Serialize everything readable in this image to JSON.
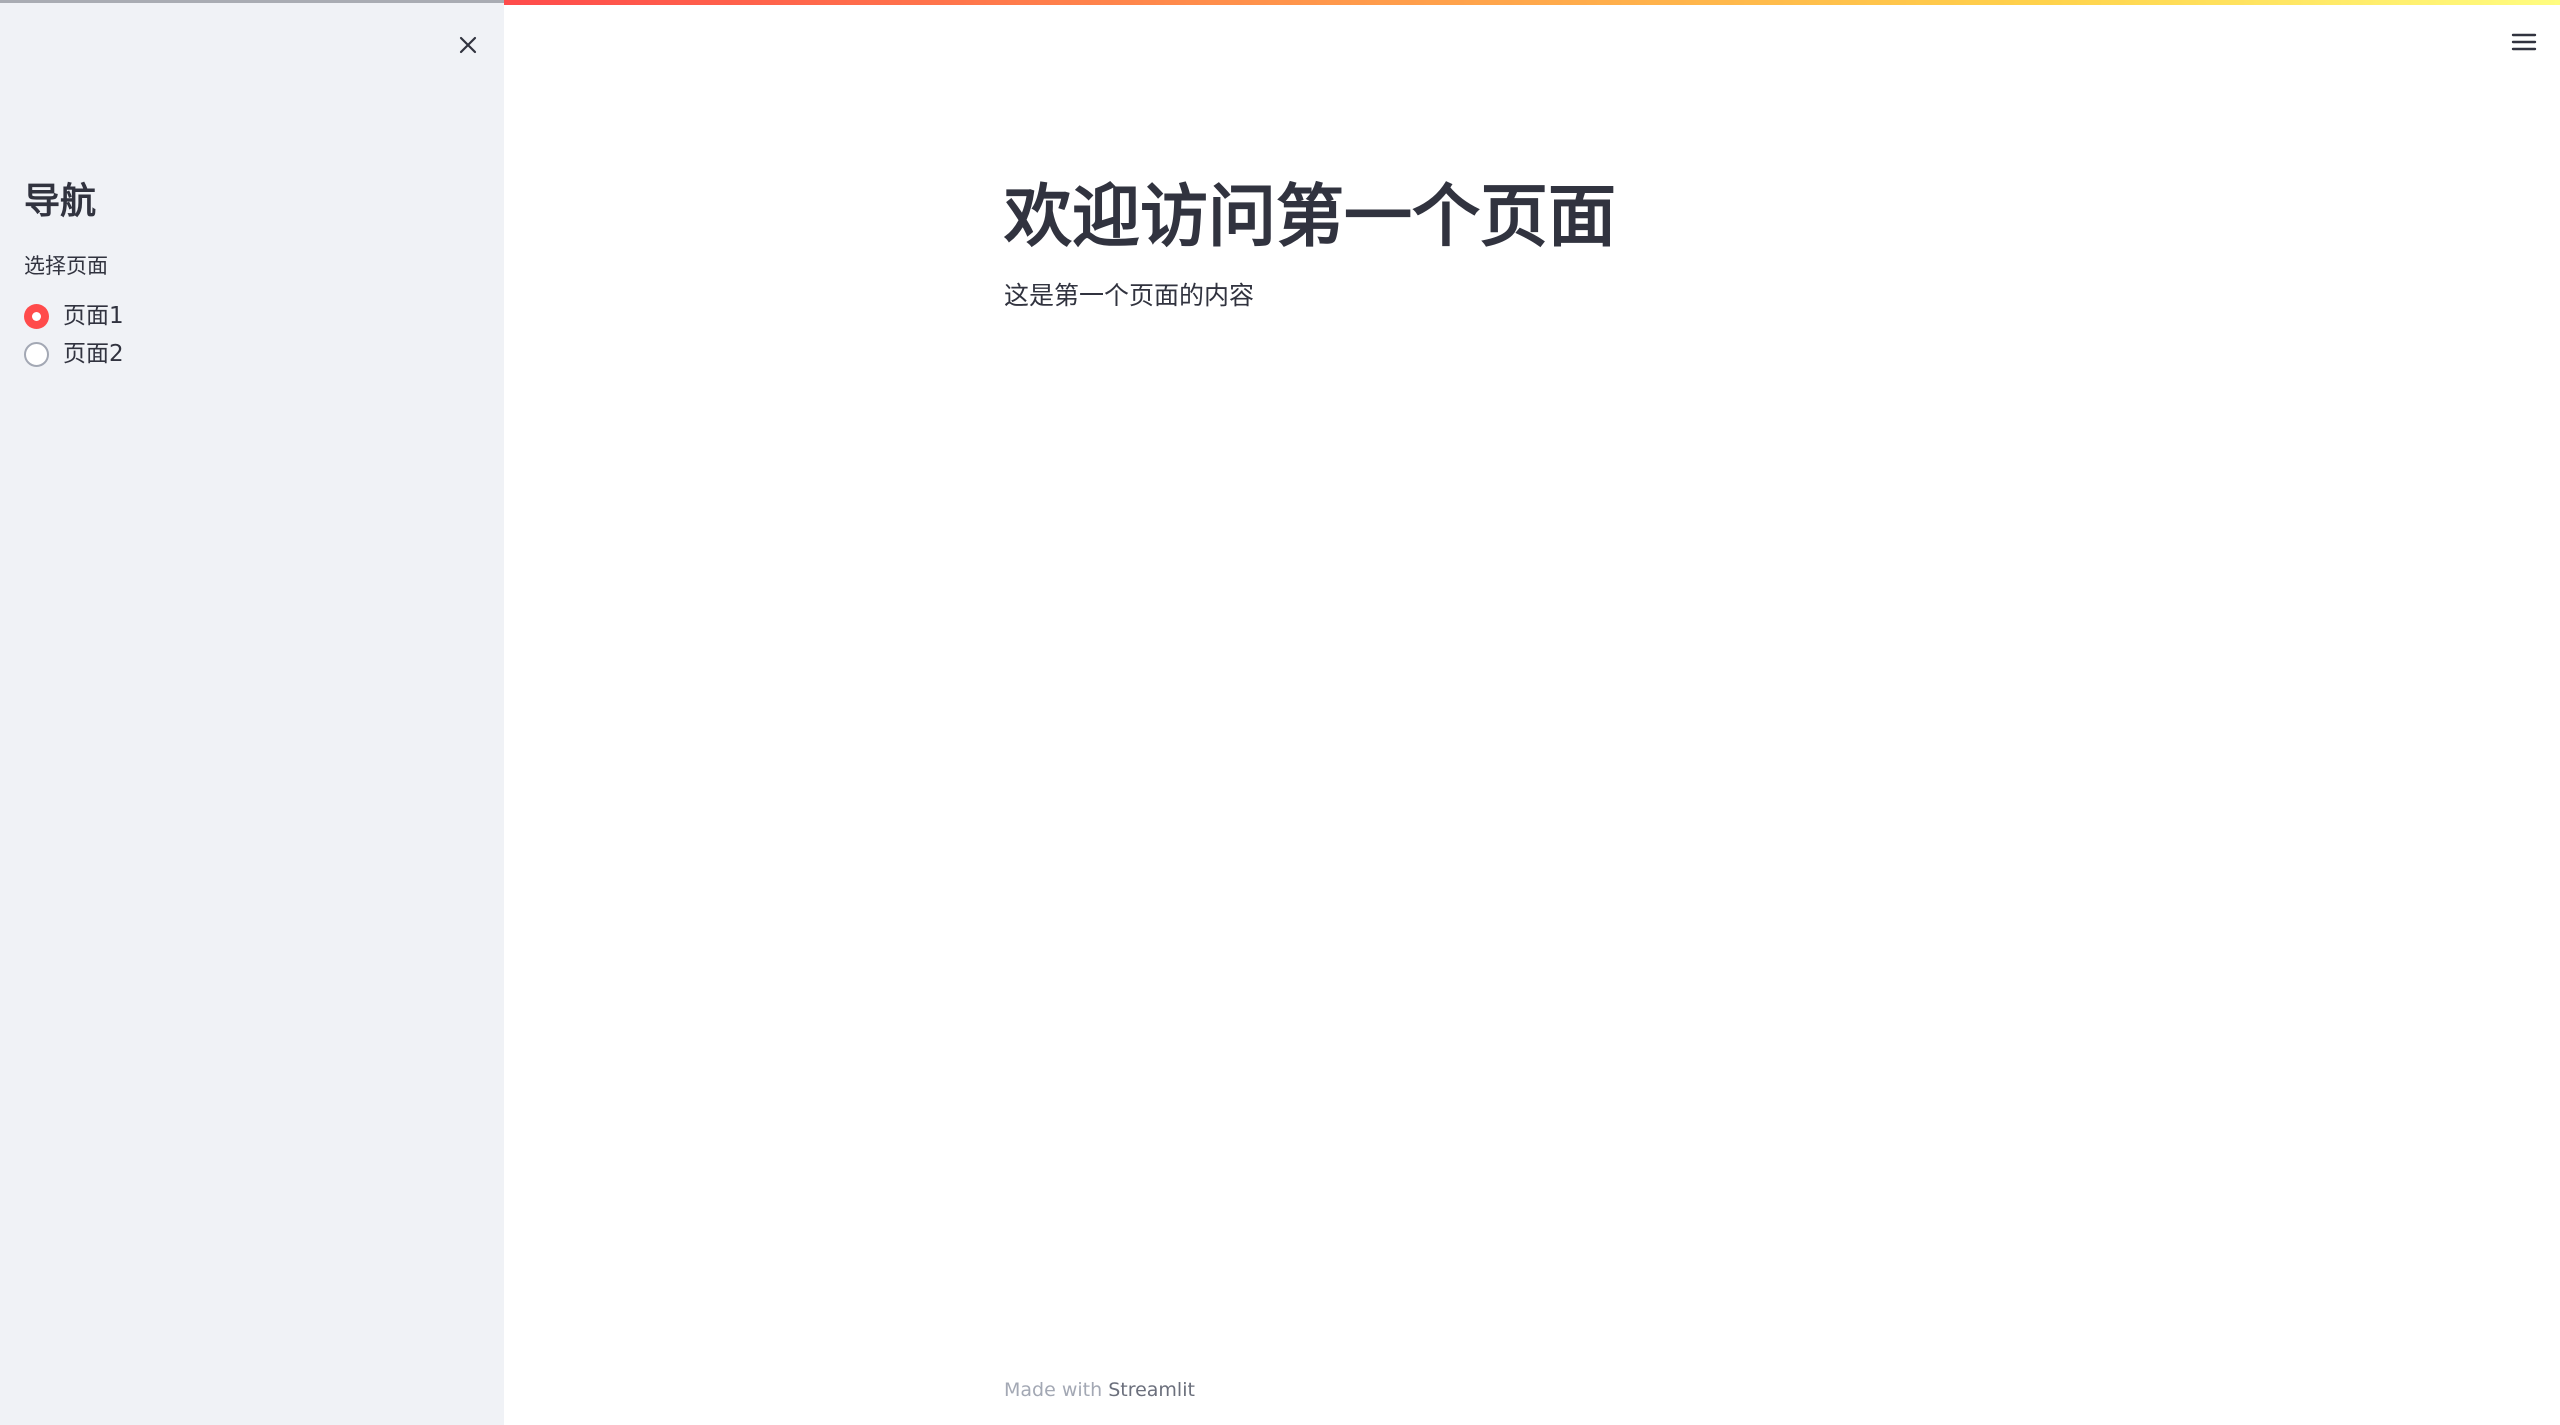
{
  "sidebar": {
    "title": "导航",
    "radio_label": "选择页面",
    "options": [
      {
        "label": "页面1",
        "selected": true
      },
      {
        "label": "页面2",
        "selected": false
      }
    ]
  },
  "main": {
    "title": "欢迎访问第一个页面",
    "text": "这是第一个页面的内容"
  },
  "footer": {
    "prefix": "Made with ",
    "brand": "Streamlit"
  },
  "icons": {
    "close": "close-icon",
    "menu": "hamburger-menu-icon"
  },
  "colors": {
    "accent": "#ff4b4b",
    "sidebar_bg": "#f0f2f6",
    "text": "#31333f"
  }
}
